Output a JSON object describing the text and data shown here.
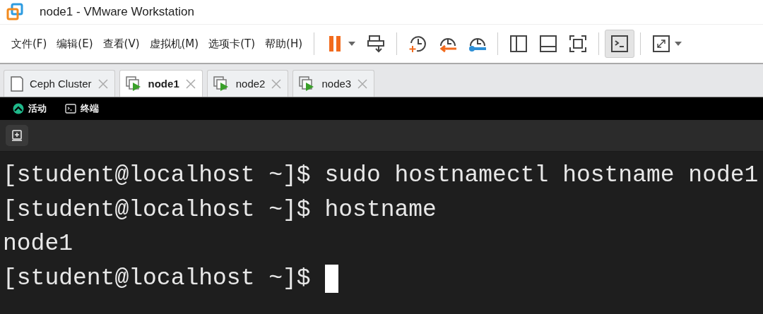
{
  "window": {
    "title": "node1 - VMware Workstation"
  },
  "menu": [
    "文件(F)",
    "编辑(E)",
    "查看(V)",
    "虚拟机(M)",
    "选项卡(T)",
    "帮助(H)"
  ],
  "toolbar": [
    {
      "kind": "pause",
      "selected": false,
      "menu": true
    },
    {
      "kind": "send-keys",
      "selected": false,
      "menu": false
    },
    {
      "kind": "separator"
    },
    {
      "kind": "snapshot",
      "selected": false,
      "menu": false
    },
    {
      "kind": "revert",
      "selected": false,
      "menu": false
    },
    {
      "kind": "snapshot-manager",
      "selected": false,
      "menu": false
    },
    {
      "kind": "separator"
    },
    {
      "kind": "library",
      "selected": false,
      "menu": false
    },
    {
      "kind": "thumbnails",
      "selected": false,
      "menu": false
    },
    {
      "kind": "fullscreen",
      "selected": false,
      "menu": false
    },
    {
      "kind": "separator"
    },
    {
      "kind": "console",
      "selected": true,
      "menu": false
    },
    {
      "kind": "separator"
    },
    {
      "kind": "stretch",
      "selected": false,
      "menu": true
    }
  ],
  "tabs": [
    {
      "label": "Ceph Cluster",
      "kind": "team",
      "selected": false
    },
    {
      "label": "node1",
      "kind": "vm",
      "selected": true
    },
    {
      "label": "node2",
      "kind": "vm",
      "selected": false
    },
    {
      "label": "node3",
      "kind": "vm",
      "selected": false
    }
  ],
  "guest_topbar": {
    "activities": "活动",
    "app": "终端"
  },
  "terminal": {
    "lines": [
      {
        "kind": "prompt",
        "prompt": "[student@localhost ~]$",
        "command": "sudo hostnamectl hostname node1",
        "cursor": false
      },
      {
        "kind": "prompt",
        "prompt": "[student@localhost ~]$",
        "command": "hostname",
        "cursor": false
      },
      {
        "kind": "output",
        "text": "node1"
      },
      {
        "kind": "prompt",
        "prompt": "[student@localhost ~]$",
        "cursor": true
      }
    ]
  }
}
